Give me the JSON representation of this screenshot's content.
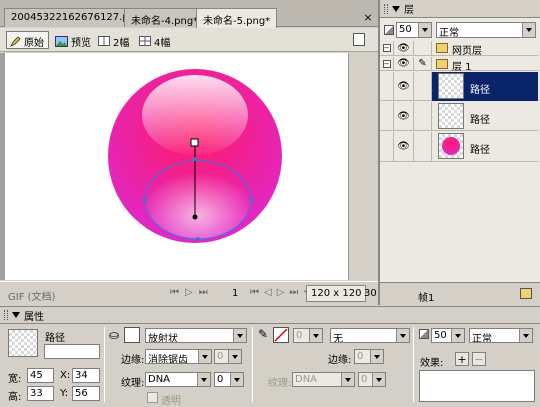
{
  "document_tabs": [
    {
      "label": "20045322162676127.png*",
      "active": false
    },
    {
      "label": "未命名-4.png*",
      "active": false
    },
    {
      "label": "未命名-5.png*",
      "active": true
    }
  ],
  "view_modes": [
    {
      "label": "原始",
      "icon": "pen-icon",
      "active": true
    },
    {
      "label": "预览",
      "icon": "image-icon",
      "active": false
    },
    {
      "label": "2幅",
      "icon": "two-up-icon",
      "active": false
    },
    {
      "label": "4幅",
      "icon": "four-up-icon",
      "active": false
    }
  ],
  "status": {
    "format": "GIF (文档)",
    "frame": "1",
    "size": "120 x 120",
    "zoom": "30"
  },
  "layers_panel": {
    "title": "层",
    "opacity": "50",
    "blend": "正常",
    "layers": [
      {
        "name": "网页层",
        "kind": "folder"
      },
      {
        "name": "层 1",
        "kind": "folder"
      },
      {
        "name": "路径",
        "kind": "object",
        "selected": true,
        "thumb": "transparent"
      },
      {
        "name": "路径",
        "kind": "object",
        "selected": false,
        "thumb": "transparent"
      },
      {
        "name": "路径",
        "kind": "object",
        "selected": false,
        "thumb": "sphere"
      }
    ],
    "frame_label": "帧1"
  },
  "properties": {
    "title": "属性",
    "object_type": "路径",
    "object_name": "",
    "width_label": "宽:",
    "width": "45",
    "height_label": "高:",
    "height": "33",
    "x_label": "X:",
    "x": "34",
    "y_label": "Y:",
    "y": "56",
    "fill_type": "放射状",
    "fill_edge_label": "边缘:",
    "fill_edge": "消除锯齿",
    "fill_edge_amount": "0",
    "fill_texture_label": "纹理:",
    "fill_texture": "DNA",
    "fill_texture_amount": "0",
    "transparent_label": "透明",
    "stroke_size": "0",
    "stroke_type": "无",
    "stroke_edge_label": "边缘:",
    "stroke_edge_amount": "0",
    "stroke_texture_label": "纹理:",
    "stroke_texture": "DNA",
    "stroke_texture_amount": "0",
    "opacity": "50",
    "blend": "正常",
    "effects_label": "效果:"
  },
  "colors": {
    "selection": "#0a246a",
    "sphere_top": "#ff1a66",
    "sphere_bottom": "#e028c8",
    "path_handle": "#3a78d8"
  }
}
